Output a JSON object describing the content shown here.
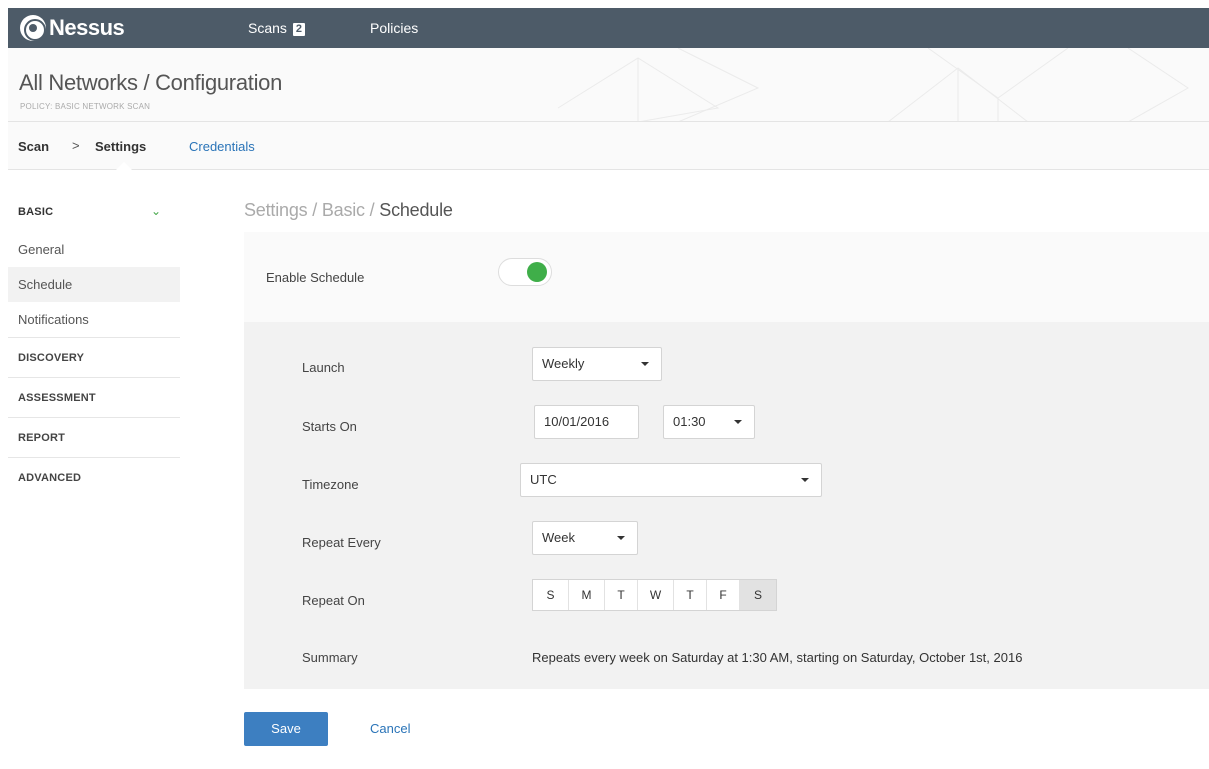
{
  "app": {
    "name": "Nessus"
  },
  "nav": {
    "scans_label": "Scans",
    "scans_count": "2",
    "policies_label": "Policies"
  },
  "header": {
    "title": "All Networks / Configuration",
    "subtitle": "POLICY: BASIC NETWORK SCAN"
  },
  "breadcrumb": {
    "scan": "Scan",
    "separator": ">",
    "settings": "Settings",
    "credentials": "Credentials"
  },
  "sidebar": {
    "section_basic": "BASIC",
    "chevron_icon": "chevron-down-icon",
    "items": [
      {
        "label": "General"
      },
      {
        "label": "Schedule",
        "active": true
      },
      {
        "label": "Notifications"
      }
    ],
    "sections": [
      {
        "label": "DISCOVERY"
      },
      {
        "label": "ASSESSMENT"
      },
      {
        "label": "REPORT"
      },
      {
        "label": "ADVANCED"
      }
    ]
  },
  "main": {
    "breadcrumb_prefix": "Settings / Basic / ",
    "breadcrumb_current": "Schedule",
    "enable_schedule": {
      "label": "Enable Schedule",
      "enabled": true
    },
    "launch": {
      "label": "Launch",
      "value": "Weekly"
    },
    "starts_on": {
      "label": "Starts On",
      "date": "10/01/2016",
      "time": "01:30"
    },
    "timezone": {
      "label": "Timezone",
      "value": "UTC"
    },
    "repeat_every": {
      "label": "Repeat Every",
      "value": "Week"
    },
    "repeat_on": {
      "label": "Repeat On",
      "days": [
        "S",
        "M",
        "T",
        "W",
        "T",
        "F",
        "S"
      ],
      "selected_day_index": 6
    },
    "summary": {
      "label": "Summary",
      "text": "Repeats every week on Saturday at 1:30 AM, starting on Saturday, October 1st, 2016"
    }
  },
  "actions": {
    "save_label": "Save",
    "cancel_label": "Cancel"
  },
  "colors": {
    "topbar": "#4d5b68",
    "accent_green": "#3fae49",
    "link_blue": "#2a74b8",
    "button_blue": "#3d7fc1"
  }
}
